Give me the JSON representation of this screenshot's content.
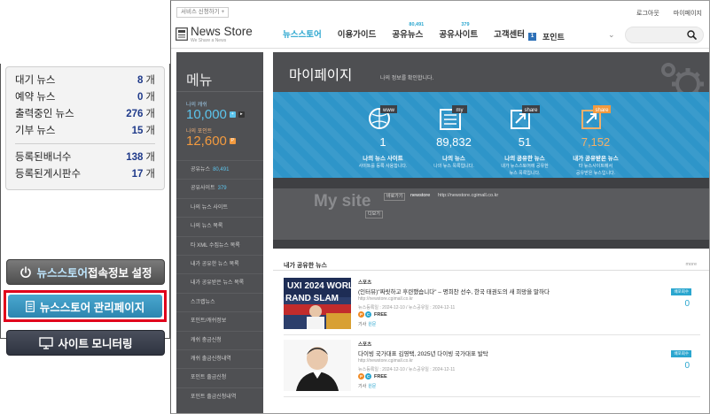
{
  "admin": {
    "stats": [
      {
        "label": "대기 뉴스",
        "value": "8",
        "unit": "개"
      },
      {
        "label": "예약 뉴스",
        "value": "0",
        "unit": "개"
      },
      {
        "label": "출력중인 뉴스",
        "value": "276",
        "unit": "개"
      },
      {
        "label": "기부 뉴스",
        "value": "15",
        "unit": "개"
      }
    ],
    "stats2": [
      {
        "label": "등록된배너수",
        "value": "138",
        "unit": "개"
      },
      {
        "label": "등록된게시판수",
        "value": "17",
        "unit": "개"
      }
    ],
    "btn_settings_accent": "뉴스스토어",
    "btn_settings_rest": " 접속정보 설정",
    "btn_manage": "뉴스스토어 관리페이지",
    "btn_monitor": "사이트 모니터링"
  },
  "site": {
    "service_tab": "서비스 신청하기 +",
    "top_links": [
      "로그아웃",
      "마이페이지"
    ],
    "logo_text": "News Store",
    "logo_sub": "We Share a News",
    "nav": [
      {
        "label": "뉴스스토어",
        "badge": ""
      },
      {
        "label": "이용가이드",
        "badge": ""
      },
      {
        "label": "공유뉴스",
        "badge": "80,491"
      },
      {
        "label": "공유사이트",
        "badge": "379"
      },
      {
        "label": "고객센터",
        "badge": ""
      }
    ],
    "point_label": "포인트",
    "point_box": "1",
    "sidebar": {
      "title": "메뉴",
      "cash_label": "나의 캐쉬",
      "cash_value": "10,000",
      "point_label": "나의 포인트",
      "point_value": "12,600",
      "items": [
        {
          "label": "공유뉴스",
          "count": "80,491"
        },
        {
          "label": "공유사이트",
          "count": "379"
        },
        {
          "label": "나의 뉴스 사이트",
          "count": ""
        },
        {
          "label": "나의 뉴스 목록",
          "count": ""
        },
        {
          "label": "타 XML 수집뉴스 목록",
          "count": ""
        },
        {
          "label": "내가 공유한 뉴스 목록",
          "count": ""
        },
        {
          "label": "내가 공유받은 뉴스 목록",
          "count": ""
        },
        {
          "label": "스크랩뉴스",
          "count": ""
        },
        {
          "label": "포인트/캐쉬정보",
          "count": ""
        },
        {
          "label": "캐쉬 충금신청",
          "count": ""
        },
        {
          "label": "캐쉬 출금신청내역",
          "count": ""
        },
        {
          "label": "포인트 출금신청",
          "count": ""
        },
        {
          "label": "포인트 출금신청내역",
          "count": ""
        }
      ]
    },
    "mypage": {
      "title": "마이페이지",
      "subtitle": "나의 정보를 확인합니다."
    },
    "band": [
      {
        "value": "1",
        "label": "나의 뉴스 사이트",
        "desc1": "사이트를 등록 사용합니다.",
        "desc2": ""
      },
      {
        "value": "89,832",
        "label": "나의 뉴스",
        "desc1": "나의 뉴스 목록입니다.",
        "desc2": ""
      },
      {
        "value": "51",
        "label": "나의 공유한 뉴스",
        "desc1": "내가 뉴스스토어에 공유한",
        "desc2": "뉴스 목록입니다."
      },
      {
        "value": "7,152",
        "label": "내가 공유받은 뉴스",
        "desc1": "타 뉴스사이트에서",
        "desc2": "공유받은 뉴스입니다."
      }
    ],
    "band_icon_tags": [
      "www",
      "my",
      "share",
      "share"
    ],
    "mysite": {
      "title": "My site",
      "btn": "바로가기",
      "name": "newstore",
      "url": "http://newstore.cgimall.co.kr",
      "btn2": "디보기"
    },
    "shared": {
      "title": "내가 공유한 뉴스",
      "more": "more",
      "items": [
        {
          "category": "스포츠",
          "title": "(인터뷰)\"짜릿하고 후련했습니다\" – 명희찬 선수, 한국 태권도의 새 희망을 말하다",
          "url": "http://newstore.cgimall.co.kr",
          "date": "뉴스등록일 : 2024-12-10 / 뉴스공유일 : 2024-12-11",
          "badge": "FREE",
          "tag_label": "기사",
          "tag": "원문",
          "side_badge": "배포회수",
          "side_value": "0"
        },
        {
          "category": "스포츠",
          "title": "다이빙 국가대표 김영택, 2025년 다이빙 국가대표 발탁",
          "url": "http://newstore.cgimall.co.kr",
          "date": "뉴스등록일 : 2024-12-10 / 뉴스공유일 : 2024-12-11",
          "badge": "FREE",
          "tag_label": "기사",
          "tag": "원문",
          "side_badge": "배포회수",
          "side_value": "0"
        }
      ]
    }
  },
  "colors": {
    "accent_blue": "#2aa6cf",
    "highlight_red": "#e0001b",
    "band_blue": "#2e95c9",
    "sidebar_gray": "#4f5053",
    "orange": "#f29a3f"
  }
}
